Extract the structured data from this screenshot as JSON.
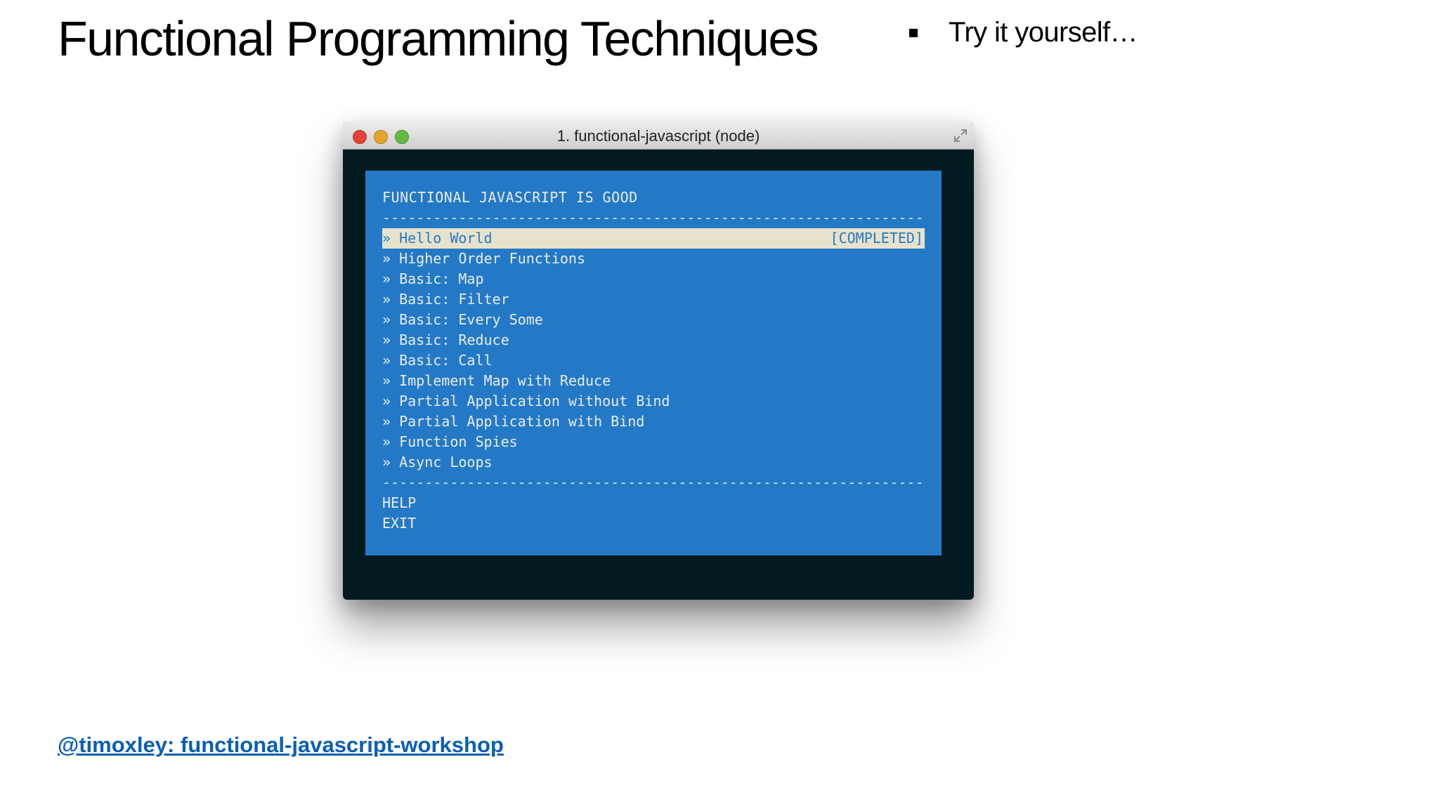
{
  "slide": {
    "title": "Functional Programming Techniques",
    "bullet": "Try it yourself…",
    "link": "@timoxley: functional-javascript-workshop"
  },
  "terminal": {
    "window_title": "1. functional-javascript (node)",
    "heading": "FUNCTIONAL JAVASCRIPT IS GOOD",
    "divider": "-------------------------------------------------------------------",
    "items": [
      {
        "label": "» Hello World",
        "status": "[COMPLETED]"
      },
      {
        "label": "» Higher Order Functions"
      },
      {
        "label": "» Basic: Map"
      },
      {
        "label": "» Basic: Filter"
      },
      {
        "label": "» Basic: Every Some"
      },
      {
        "label": "» Basic: Reduce"
      },
      {
        "label": "» Basic: Call"
      },
      {
        "label": "» Implement Map with Reduce"
      },
      {
        "label": "» Partial Application without Bind"
      },
      {
        "label": "» Partial Application with Bind"
      },
      {
        "label": "» Function Spies"
      },
      {
        "label": "» Async Loops"
      }
    ],
    "footer_items": [
      "HELP",
      "EXIT"
    ]
  },
  "colors": {
    "terminal_panel": "#2479c6",
    "terminal_background": "#041a21",
    "selected_row": "#e7e2cc",
    "link": "#0b5fb5"
  }
}
